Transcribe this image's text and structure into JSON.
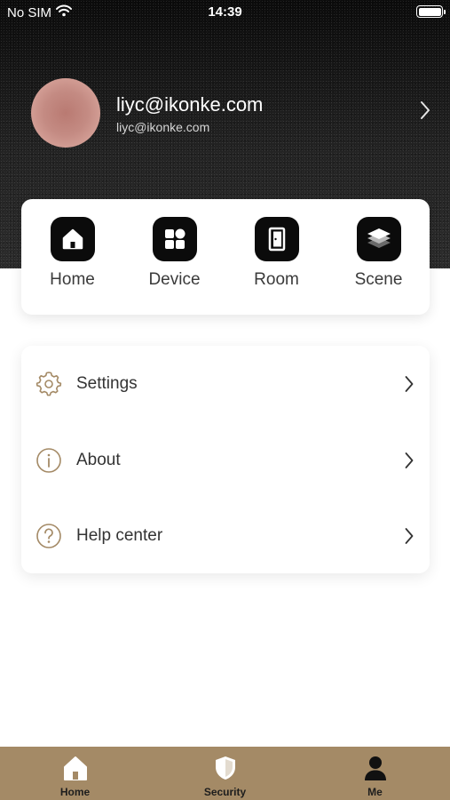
{
  "status_bar": {
    "carrier": "No SIM",
    "time": "14:39"
  },
  "profile": {
    "name": "liyc@ikonke.com",
    "email": "liyc@ikonke.com"
  },
  "quick_access": [
    {
      "label": "Home",
      "icon": "home-icon"
    },
    {
      "label": "Device",
      "icon": "device-grid-icon"
    },
    {
      "label": "Room",
      "icon": "door-icon"
    },
    {
      "label": "Scene",
      "icon": "layers-icon"
    }
  ],
  "menu": [
    {
      "label": "Settings",
      "icon": "gear-icon"
    },
    {
      "label": "About",
      "icon": "info-icon"
    },
    {
      "label": "Help center",
      "icon": "question-icon"
    }
  ],
  "tabs": [
    {
      "label": "Home",
      "icon": "home-icon"
    },
    {
      "label": "Security",
      "icon": "shield-icon"
    },
    {
      "label": "Me",
      "icon": "person-icon"
    }
  ],
  "colors": {
    "header_background": "#141414",
    "tab_bar": "#a48a66",
    "menu_icon": "#a48a66",
    "quick_icon_background": "#0b0b0b"
  }
}
